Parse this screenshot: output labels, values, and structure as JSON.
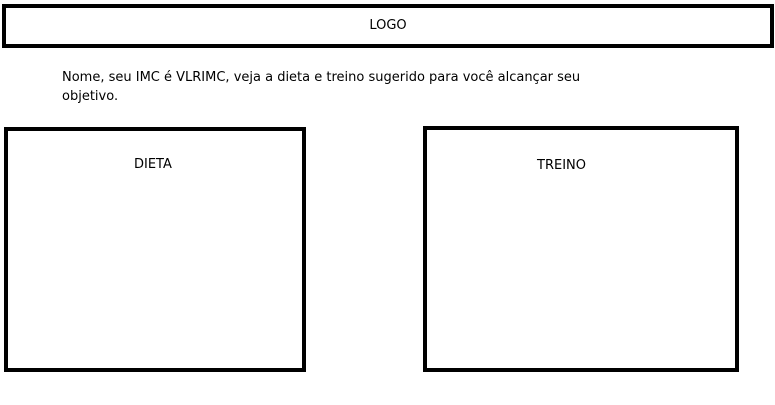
{
  "header": {
    "logo_text": "LOGO"
  },
  "intro": {
    "text": "Nome, seu IMC é VLRIMC, veja a dieta e treino sugerido para você alcançar seu objetivo."
  },
  "panels": {
    "diet": {
      "title": "DIETA"
    },
    "training": {
      "title": "TREINO"
    }
  },
  "colors": {
    "background": "#ffffff",
    "border": "#000000",
    "text": "#000000"
  }
}
